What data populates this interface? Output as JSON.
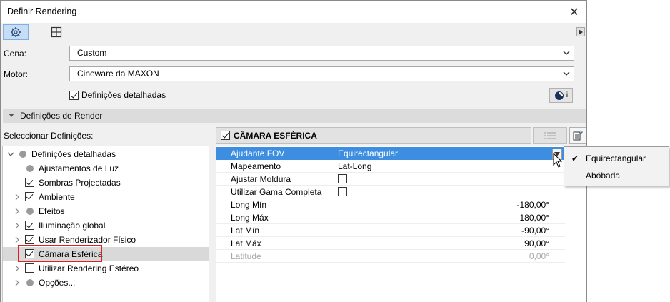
{
  "window": {
    "title": "Definir Rendering"
  },
  "toolbar": {
    "tabs": [
      {
        "icon": "gear-icon"
      },
      {
        "icon": "grid-icon"
      }
    ],
    "scroll_icon": "triangle-right-icon"
  },
  "scene": {
    "label": "Cena:",
    "value": "Custom"
  },
  "engine": {
    "label": "Motor:",
    "value": "Cineware da MAXON"
  },
  "detailed": {
    "label": "Definições detalhadas",
    "checked": true,
    "info_letter": "i"
  },
  "section": {
    "title": "Definições de Render"
  },
  "select_settings_label": "Seleccionar Definições:",
  "tree": {
    "root": {
      "label": "Definições detalhadas"
    },
    "items": [
      {
        "label": "Ajustamentos de Luz",
        "type": "dot"
      },
      {
        "label": "Sombras Projectadas",
        "type": "checkbox",
        "checked": true
      },
      {
        "label": "Ambiente",
        "type": "checkbox",
        "checked": true,
        "expandable": true
      },
      {
        "label": "Efeitos",
        "type": "dot",
        "expandable": true
      },
      {
        "label": "Iluminação global",
        "type": "checkbox",
        "checked": true,
        "expandable": true
      },
      {
        "label": "Usar Renderizador Físico",
        "type": "checkbox",
        "checked": true,
        "expandable": true
      },
      {
        "label": "Câmara Esférica",
        "type": "checkbox",
        "checked": true,
        "selected": true
      },
      {
        "label": "Utilizar Rendering Estéreo",
        "type": "checkbox",
        "checked": false,
        "expandable": true
      },
      {
        "label": "Opções...",
        "type": "dot",
        "expandable": true
      }
    ]
  },
  "panel": {
    "title": "CÂMARA ESFÉRICA",
    "properties": [
      {
        "name": "Ajudante FOV",
        "value": "Equirectangular"
      },
      {
        "name": "Mapeamento",
        "value": "Lat-Long"
      },
      {
        "name": "Ajustar Moldura",
        "checkbox": false
      },
      {
        "name": "Utilizar Gama Completa",
        "checkbox": false
      },
      {
        "name": "Long Mín",
        "value": "-180,00°"
      },
      {
        "name": "Long Máx",
        "value": "180,00°"
      },
      {
        "name": "Lat Mín",
        "value": "-90,00°"
      },
      {
        "name": "Lat Máx",
        "value": "90,00°"
      },
      {
        "name": "Latitude",
        "value": "0,00°"
      }
    ]
  },
  "dropdown": {
    "options": [
      {
        "label": "Equirectangular",
        "checked": true
      },
      {
        "label": "Abóbada",
        "checked": false
      }
    ]
  },
  "colors": {
    "highlight": "#3d8ee0",
    "selection_box": "#e02020"
  }
}
